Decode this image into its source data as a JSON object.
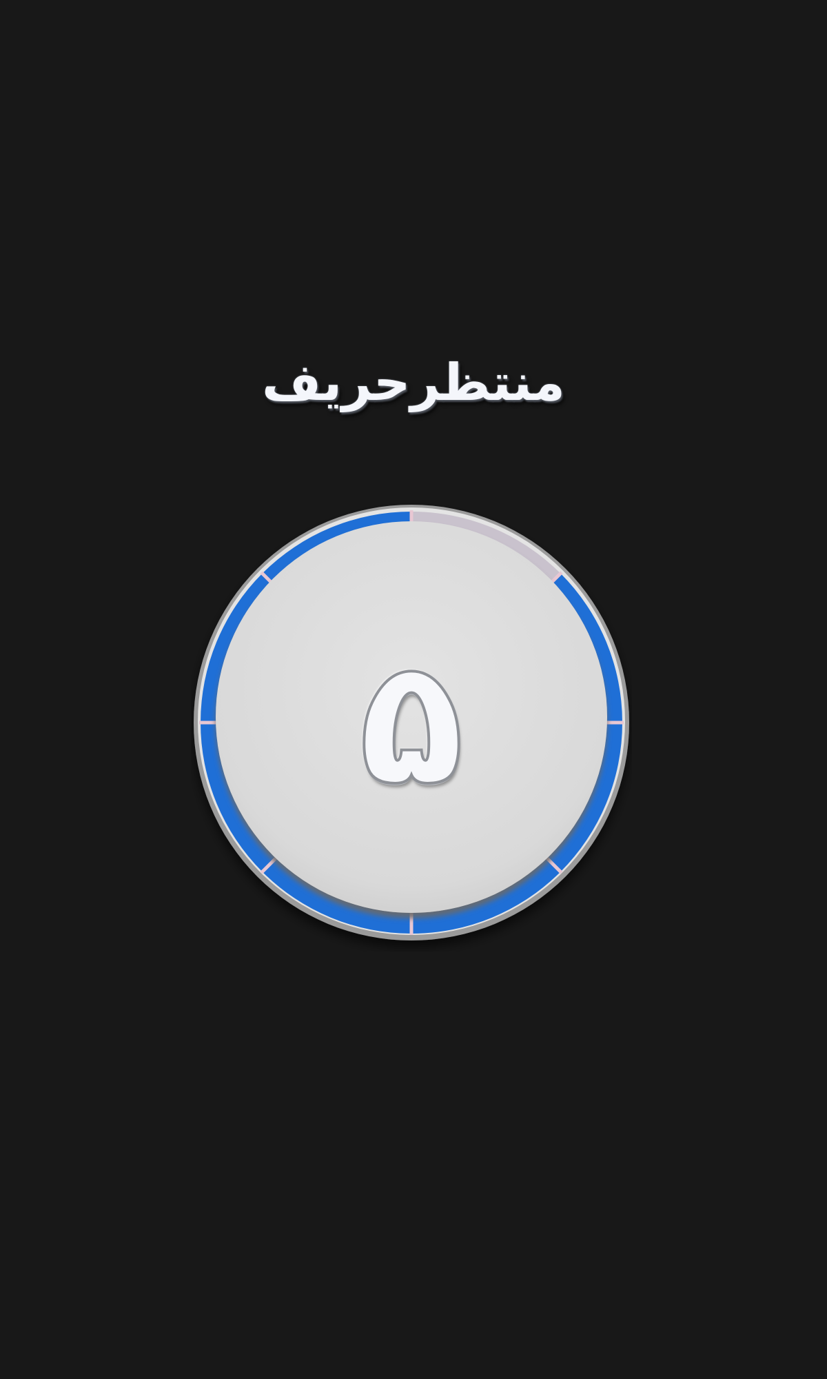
{
  "status": {
    "title": "منتظرحریف"
  },
  "timer": {
    "value": "۵",
    "total_segments": 8,
    "remaining_segments": 7,
    "colors": {
      "active": "#1f6fd6",
      "spent": "#c9c2cd",
      "divider": "#e8c7d3",
      "face": "#dcdcdc",
      "background": "#181818"
    }
  }
}
